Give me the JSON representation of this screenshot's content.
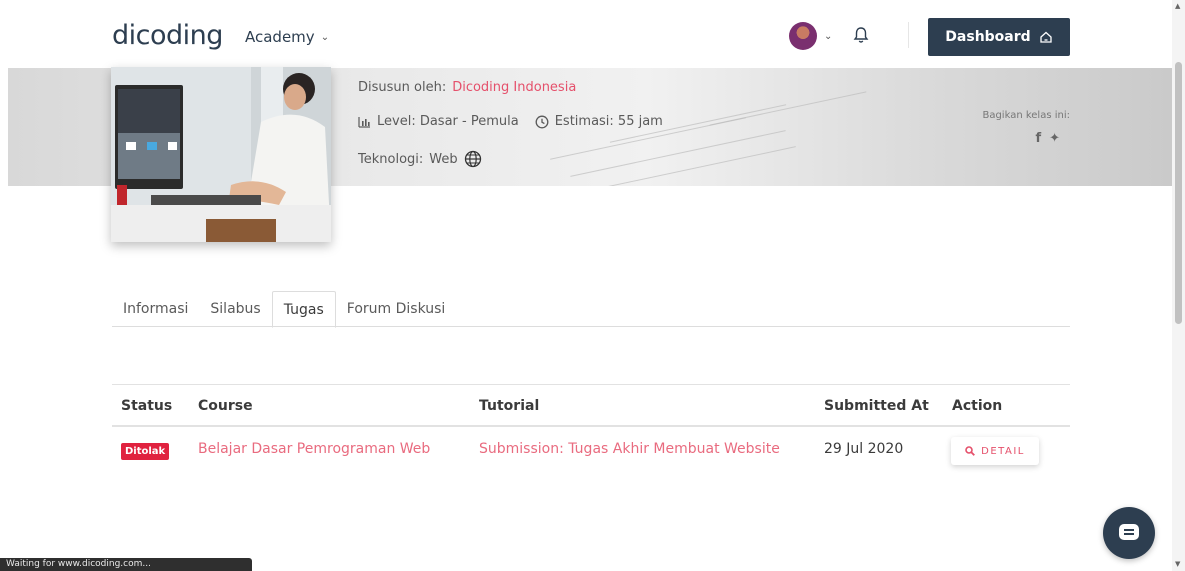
{
  "header": {
    "logo": "dicoding",
    "academy_label": "Academy",
    "dashboard_label": "Dashboard"
  },
  "course": {
    "author_prefix": "Disusun oleh:",
    "author": "Dicoding Indonesia",
    "level": "Level: Dasar - Pemula",
    "estimate": "Estimasi: 55 jam",
    "tech_prefix": "Teknologi:",
    "tech": "Web",
    "share_label": "Bagikan kelas ini:"
  },
  "tabs": [
    {
      "label": "Informasi",
      "active": false
    },
    {
      "label": "Silabus",
      "active": false
    },
    {
      "label": "Tugas",
      "active": true
    },
    {
      "label": "Forum Diskusi",
      "active": false
    }
  ],
  "table": {
    "headers": [
      "Status",
      "Course",
      "Tutorial",
      "Submitted At",
      "Action"
    ],
    "rows": [
      {
        "status": "Ditolak",
        "course": "Belajar Dasar Pemrograman Web",
        "tutorial": "Submission: Tugas Akhir Membuat Website",
        "submitted_at": "29 Jul 2020",
        "action": "DETAIL"
      }
    ]
  },
  "statusbar": "Waiting for www.dicoding.com...",
  "colors": {
    "brand_navy": "#2d3e50",
    "accent_pink": "#e5506b",
    "badge_red": "#e0223f"
  }
}
